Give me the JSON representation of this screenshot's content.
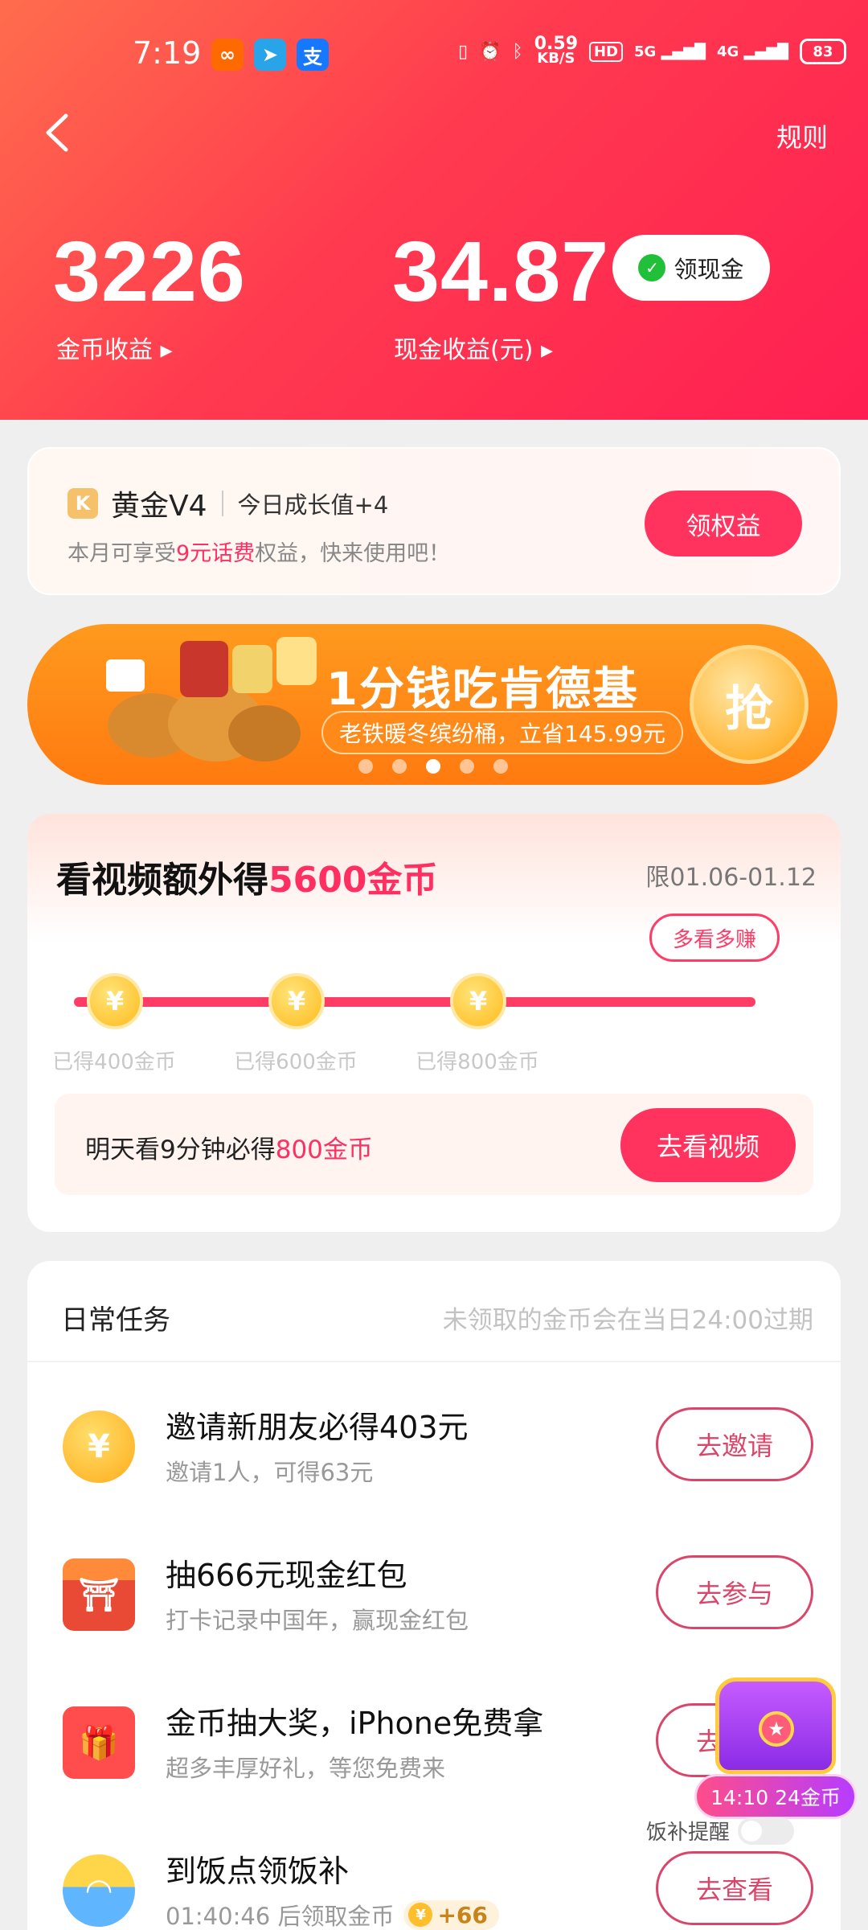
{
  "status_bar": {
    "time": "7:19",
    "net_speed_value": "0.59",
    "net_speed_unit": "KB/S",
    "hd": "HD",
    "signal1": "5G",
    "signal2": "4G",
    "battery": "83"
  },
  "header": {
    "rules": "规则",
    "coin_value": "3226",
    "coin_label": "金币收益 ▸",
    "cash_value": "34.87",
    "cash_label": "现金收益(元) ▸",
    "withdraw_label": "领现金"
  },
  "vip": {
    "level": "黄金V4",
    "growth": "今日成长值+4",
    "desc_prefix": "本月可享受",
    "desc_highlight": "9元话费",
    "desc_suffix": "权益，快来使用吧！",
    "button": "领权益"
  },
  "banner": {
    "title": "1分钱吃肯德基",
    "subtitle": "老铁暖冬缤纷桶，立省145.99元",
    "grab": "抢",
    "slides": 5,
    "active_slide": 3
  },
  "video_task": {
    "title_prefix": "看视频额外得",
    "title_highlight": "5600金币",
    "date_range": "限01.06-01.12",
    "bubble": "多看多赚",
    "milestones": [
      {
        "label": "已得400金币"
      },
      {
        "label": "已得600金币"
      },
      {
        "label": "已得800金币"
      }
    ],
    "row_prefix": "明天看9分钟必得",
    "row_highlight": "800金币",
    "button": "去看视频"
  },
  "daily_tasks": {
    "title": "日常任务",
    "note": "未领取的金币会在当日24:00过期",
    "items": [
      {
        "title": "邀请新朋友必得403元",
        "sub": "邀请1人，可得63元",
        "button": "去邀请",
        "icon": "coin-icon"
      },
      {
        "title": "抽666元现金红包",
        "sub": "打卡记录中国年，赢现金红包",
        "button": "去参与",
        "icon": "temple-icon"
      },
      {
        "title": "金币抽大奖，iPhone免费拿",
        "sub": "超多丰厚好礼，等您免费来",
        "button": "去抽奖",
        "icon": "gift-icon"
      },
      {
        "title": "到饭点领饭补",
        "sub": "01:40:46 后领取金币",
        "badge": "+66",
        "button": "去查看",
        "icon": "rice-bowl-icon"
      }
    ]
  },
  "floating": {
    "timer": "14:10 24金币",
    "reminder": "饭补提醒"
  },
  "colors": {
    "accent": "#ff335e",
    "header_start": "#ff6d4d",
    "header_end": "#ff1f52",
    "banner": "#ff8a1a"
  }
}
